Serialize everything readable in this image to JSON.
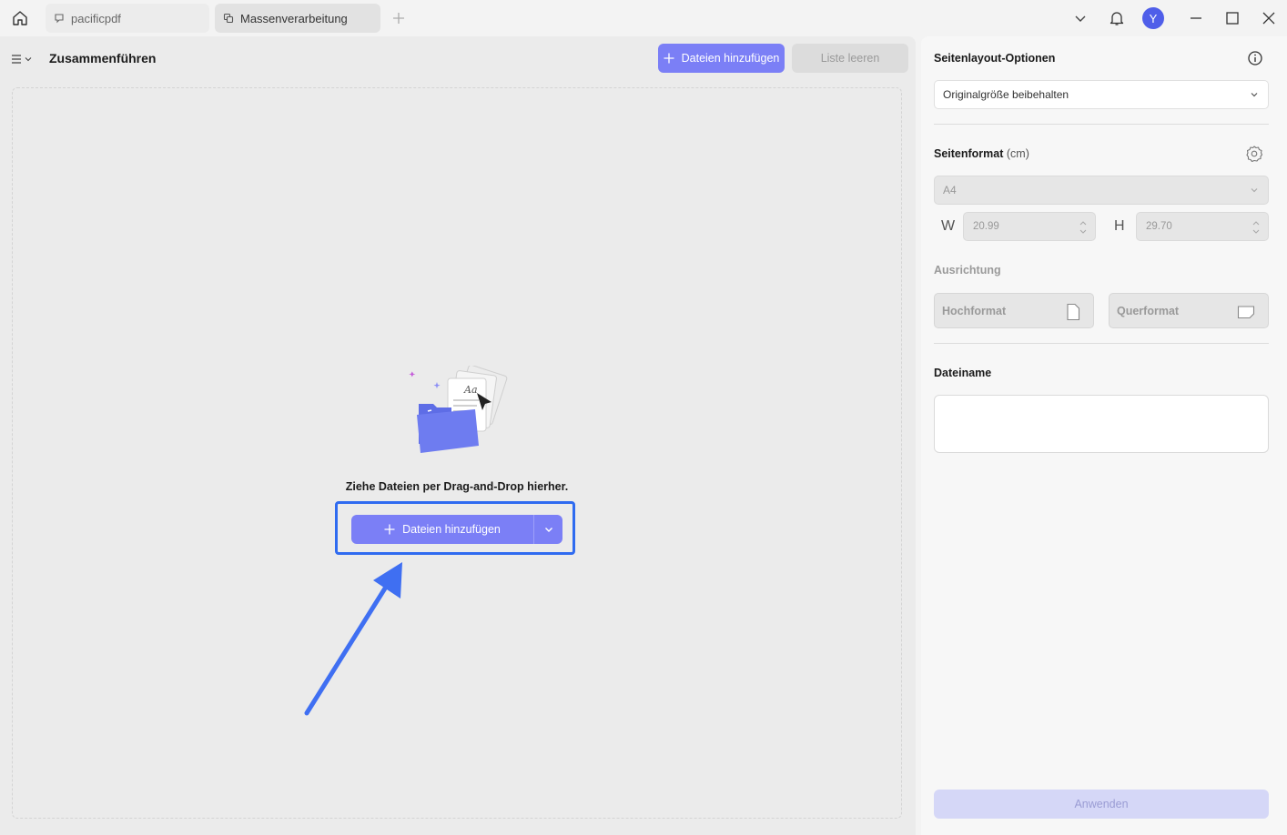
{
  "titlebar": {
    "tabs": [
      {
        "label": "pacificpdf",
        "icon": "chat-bubble-icon"
      },
      {
        "label": "Massenverarbeitung",
        "icon": "batch-copy-icon"
      }
    ],
    "avatar_initial": "Y"
  },
  "left": {
    "title": "Zusammenführen",
    "add_files_label": "Dateien hinzufügen",
    "clear_list_label": "Liste leeren",
    "drop_text": "Ziehe Dateien per Drag-and-Drop hierher.",
    "main_add_label": "Dateien hinzufügen",
    "illustration_text": "Aa"
  },
  "right": {
    "layout_options_label": "Seitenlayout-Optionen",
    "layout_select_value": "Originalgröße beibehalten",
    "page_format_label": "Seitenformat",
    "page_format_unit": "(cm)",
    "format_select_value": "A4",
    "width_letter": "W",
    "width_value": "20.99",
    "height_letter": "H",
    "height_value": "29.70",
    "orientation_label": "Ausrichtung",
    "portrait_label": "Hochformat",
    "landscape_label": "Querformat",
    "filename_label": "Dateiname",
    "filename_value": "",
    "apply_label": "Anwenden"
  },
  "colors": {
    "accent": "#7b7ff6",
    "highlight": "#2f6bf0",
    "avatar": "#4f5ee9"
  }
}
